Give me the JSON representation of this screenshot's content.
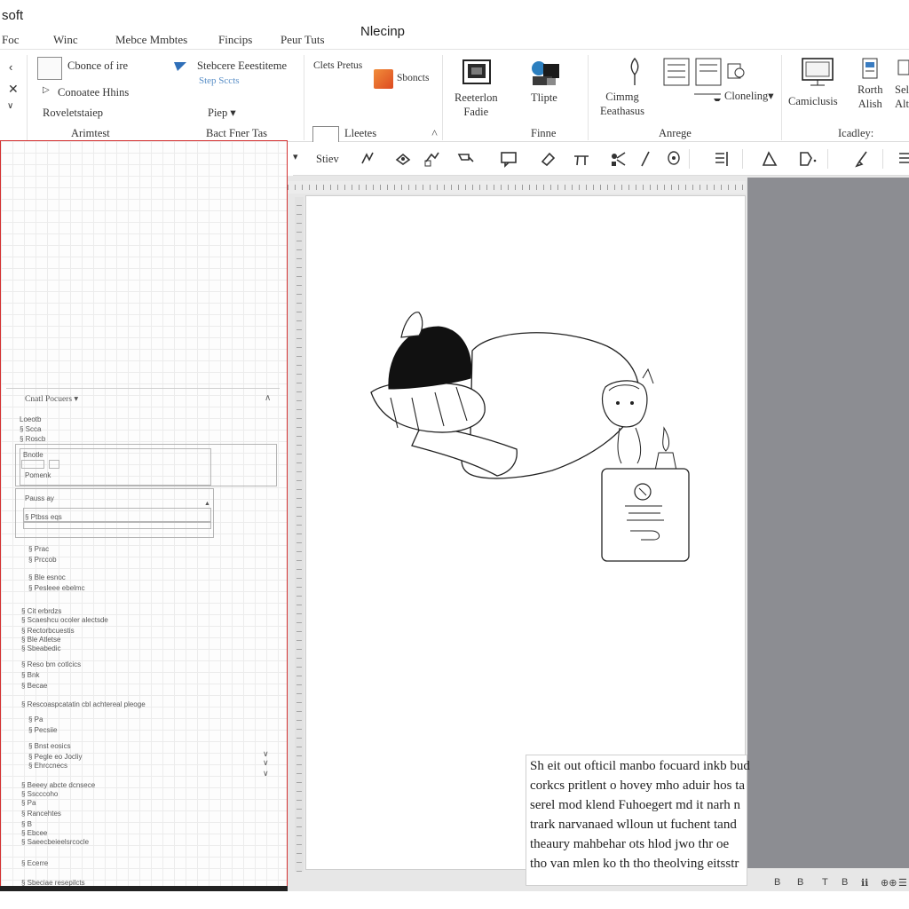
{
  "titlebar": {
    "app_title": "soft",
    "tabs": [
      "Foc",
      "Winc",
      "Mebce Mmbtes",
      "Fincips",
      "Peur Tuts"
    ],
    "doc_title": "Nlecinp"
  },
  "ribbon": {
    "left_marks": [
      "✕",
      "∨"
    ],
    "group1": {
      "items": [
        "Cbonce of ire",
        "Conoatee Hhins",
        "Roveletstaiep"
      ],
      "label": "Arimtest"
    },
    "group2": {
      "items": [
        "Stebcere Eeestiteme",
        "Step Sccts",
        "Piep ▾"
      ],
      "label": "Bact Fner Tas"
    },
    "group3": {
      "items": [
        "Clets Pretus",
        "Sboncts"
      ],
      "label": "Lleetes"
    },
    "group4": {
      "items": [
        "Reeterlon\nFadie",
        "Tlipte"
      ],
      "label": "Finne"
    },
    "group5": {
      "items": [
        "Cimmg\nEeathasus",
        "Cloneling▾"
      ],
      "label": "Anrege"
    },
    "group6": {
      "items": [
        "Camiclusis",
        "Rorth\nAlish",
        "Sel\nAlt"
      ],
      "label": "Icadley:"
    }
  },
  "toolbar": {
    "style_label": "Stiev"
  },
  "left_pane": {
    "header": "Cnatl Pocuers ▾",
    "panel_titles": [
      "Bnotle",
      "Pauss ay"
    ],
    "tree": [
      "Loeotb",
      "§ Scca",
      "§ Roscb",
      "Pomenk",
      "§ Ptbss eqs",
      "§ Prac",
      "§ Prccob",
      "§ Ble esnoc",
      "§ Pesleee ebelmc",
      "§ Cit erbrdzs",
      "§ Scaeshcu ocoler alectsde",
      "§ Rectorbcuestis",
      "§ Ble Atletse",
      "§ Sbeabedic",
      "§ Reso bm cotlcics",
      "§ Bnk",
      "§ Becae",
      "§ Rescoaspcatatin cbl achtereal pleoge",
      "§ Pa",
      "§ Pecsiie",
      "§ Bnst eosics",
      "§ Pegle eo Jocliy",
      "§ Ehrccnecs",
      "§ Beeey abcte dcnsece",
      "§ Sscccoho",
      "§ Pa",
      "§ Rancehtes",
      "§ B",
      "§ Ebcee",
      "§ Saeecbeieelsrcocle",
      "§ Ecerre",
      "§ Sbeciae resepilcts"
    ]
  },
  "document": {
    "text_lines": [
      "Sh eit out ofticil manbo focuard inkb bud",
      "corkcs pritlent o hovey mho aduir hos ta",
      "serel mod klend Fuhoegert md it narh n",
      "trark narvanaed wlloun ut fuchent tand",
      "theaury mahbehar ots hlod jwo thr oe",
      "tho van mlen ko th tho theolving eitsstr"
    ]
  },
  "statusbar": {
    "items": [
      "B",
      "B",
      "T",
      "B",
      "ℹℹ",
      "⊕⊕",
      "☰"
    ]
  },
  "colors": {
    "accent_red": "#d32f2f",
    "ribbon_blue": "#3a7cc1",
    "canvas_gray": "#8c8d92",
    "orange_icon": "#e8642a"
  }
}
